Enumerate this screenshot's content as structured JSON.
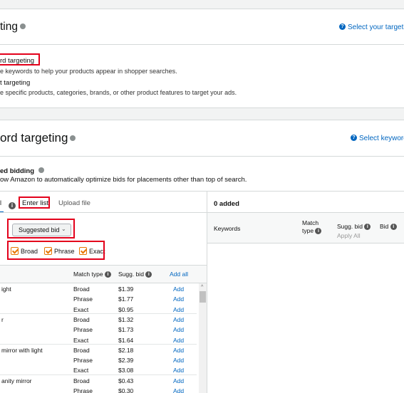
{
  "targeting_section": {
    "title": "ting",
    "help_link": "Select your targetin",
    "options": [
      {
        "label": "rd targeting",
        "description": "e keywords to help your products appear in shopper searches."
      },
      {
        "label": "t targeting",
        "description": "e specific products, categories, brands, or other product features to target your ads."
      }
    ]
  },
  "keyword_section": {
    "title": "ord targeting",
    "help_link": "Select keyword",
    "bidding_title": "ed bidding",
    "bidding_desc": "ow Amazon to automatically optimize bids for placements other than top of search."
  },
  "tabs": {
    "enter_list": "Enter list",
    "upload_file": "Upload file"
  },
  "filters": {
    "suggested_bid": "Suggested bid",
    "broad": "Broad",
    "phrase": "Phrase",
    "exact": "Exact"
  },
  "left_table": {
    "headers": {
      "match_type": "Match type",
      "sugg_bid": "Sugg. bid",
      "add_all": "Add all"
    },
    "rows": [
      {
        "keyword": "ight",
        "match": "Broad",
        "bid": "$1.39",
        "action": "Add"
      },
      {
        "keyword": "",
        "match": "Phrase",
        "bid": "$1.77",
        "action": "Add"
      },
      {
        "keyword": "",
        "match": "Exact",
        "bid": "$0.95",
        "action": "Add"
      },
      {
        "keyword": "r",
        "match": "Broad",
        "bid": "$1.32",
        "action": "Add"
      },
      {
        "keyword": "",
        "match": "Phrase",
        "bid": "$1.73",
        "action": "Add"
      },
      {
        "keyword": "",
        "match": "Exact",
        "bid": "$1.64",
        "action": "Add"
      },
      {
        "keyword": "mirror with light",
        "match": "Broad",
        "bid": "$2.18",
        "action": "Add"
      },
      {
        "keyword": "",
        "match": "Phrase",
        "bid": "$2.39",
        "action": "Add"
      },
      {
        "keyword": "",
        "match": "Exact",
        "bid": "$3.08",
        "action": "Add"
      },
      {
        "keyword": "anity mirror",
        "match": "Broad",
        "bid": "$0.43",
        "action": "Add"
      },
      {
        "keyword": "",
        "match": "Phrase",
        "bid": "$0.30",
        "action": "Add"
      }
    ]
  },
  "right_panel": {
    "added_count": "0 added",
    "headers": {
      "keywords": "Keywords",
      "match_type_1": "Match",
      "match_type_2": "type",
      "sugg_bid": "Sugg. bid",
      "apply_all": "Apply All",
      "bid": "Bid"
    }
  }
}
